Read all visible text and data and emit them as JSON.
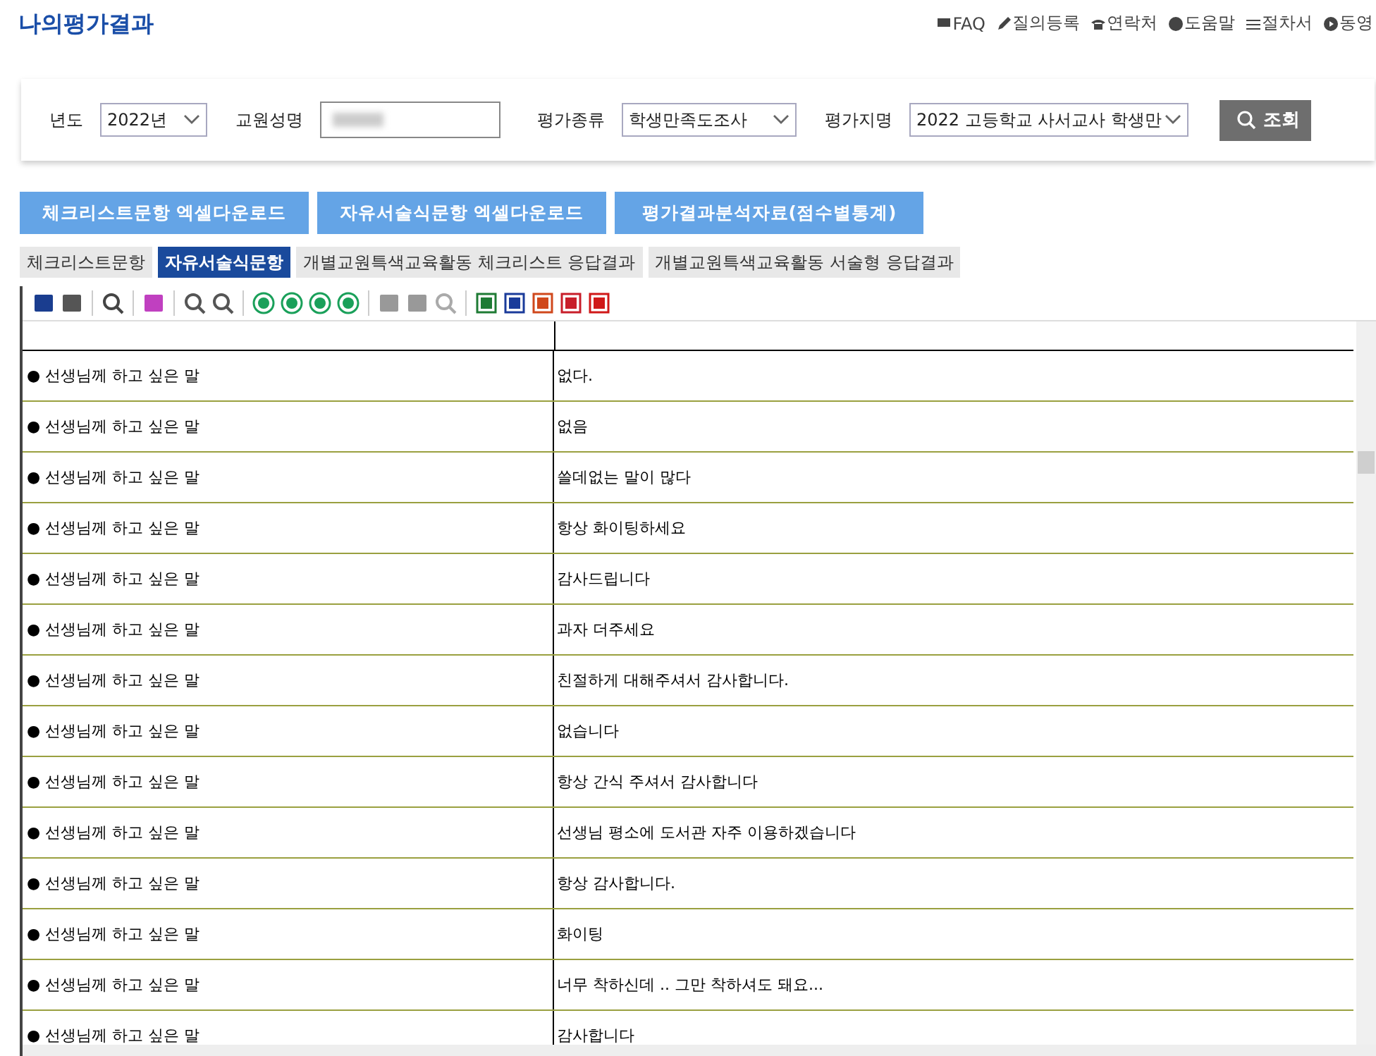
{
  "page_title": "나의평가결과",
  "top_links": [
    {
      "label": "FAQ"
    },
    {
      "label": "질의등록"
    },
    {
      "label": "연락처"
    },
    {
      "label": "도움말"
    },
    {
      "label": "절차서"
    },
    {
      "label": "동영"
    }
  ],
  "filters": [
    {
      "kind": "select",
      "label": "년도",
      "value": "2022년"
    },
    {
      "kind": "redacted",
      "label": "교원성명"
    },
    {
      "kind": "select",
      "label": "평가종류",
      "value": "학생만족도조사"
    },
    {
      "kind": "select",
      "label": "평가지명",
      "value": "2022 고등학교 사서교사 학생만"
    }
  ],
  "search_button": "조회",
  "download_buttons": [
    "체크리스트문항 엑셀다운로드",
    "자유서술식문항 엑셀다운로드",
    "평가결과분석자료(점수별통계)"
  ],
  "tabs": [
    {
      "label": "체크리스트문항",
      "selected": false
    },
    {
      "label": "자유서술식문항",
      "selected": true
    },
    {
      "label": "개별교원특색교육활동 체크리스트 응답결과",
      "selected": false
    },
    {
      "label": "개별교원특색교육활동 서술형 응답결과",
      "selected": false
    }
  ],
  "rows": [
    {
      "question": "● 선생님께 하고 싶은 말",
      "answer": "없다."
    },
    {
      "question": "● 선생님께 하고 싶은 말",
      "answer": "없음"
    },
    {
      "question": "● 선생님께 하고 싶은 말",
      "answer": "쓸데없는 말이 많다"
    },
    {
      "question": "● 선생님께 하고 싶은 말",
      "answer": "항상 화이팅하세요"
    },
    {
      "question": "● 선생님께 하고 싶은 말",
      "answer": "감사드립니다"
    },
    {
      "question": "● 선생님께 하고 싶은 말",
      "answer": "과자 더주세요"
    },
    {
      "question": "● 선생님께 하고 싶은 말",
      "answer": "친절하게 대해주셔서 감사합니다."
    },
    {
      "question": "● 선생님께 하고 싶은 말",
      "answer": "없습니다"
    },
    {
      "question": "● 선생님께 하고 싶은 말",
      "answer": "항상 간식 주셔서 감사합니다"
    },
    {
      "question": "● 선생님께 하고 싶은 말",
      "answer": "선생님 평소에 도서관 자주 이용하겠습니다"
    },
    {
      "question": "● 선생님께 하고 싶은 말",
      "answer": "항상 감사합니다."
    },
    {
      "question": "● 선생님께 하고 싶은 말",
      "answer": "화이팅"
    },
    {
      "question": "● 선생님께 하고 싶은 말",
      "answer": "너무 착하신데 .. 그만 착하셔도 돼요..."
    },
    {
      "question": "● 선생님께 하고 싶은 말",
      "answer": "감사합니다"
    }
  ]
}
